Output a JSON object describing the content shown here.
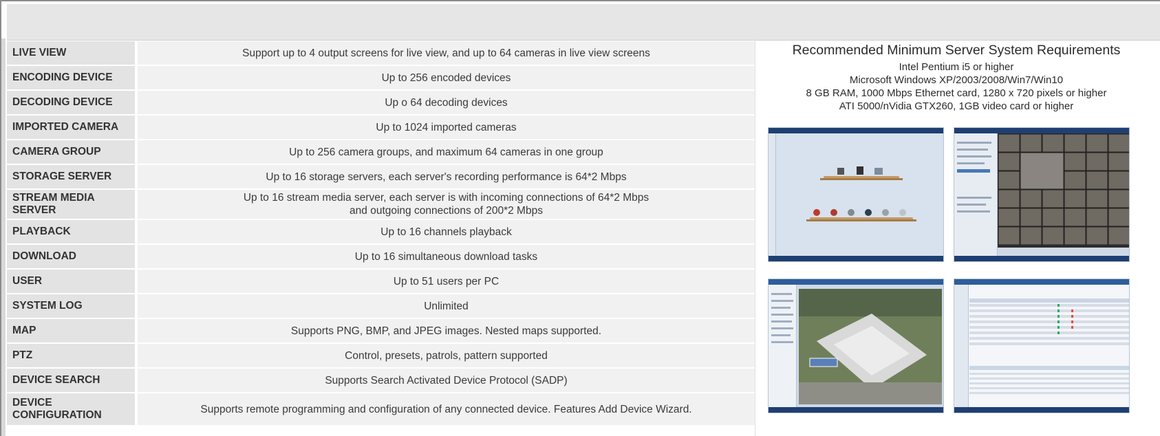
{
  "specs": [
    {
      "label": "LIVE VIEW",
      "value": "Support up to 4 output screens for live view, and up to 64 cameras in live view screens"
    },
    {
      "label": "ENCODING DEVICE",
      "value": "Up to 256 encoded devices"
    },
    {
      "label": "DECODING DEVICE",
      "value": "Up o 64 decoding devices"
    },
    {
      "label": "IMPORTED CAMERA",
      "value": "Up to 1024 imported cameras"
    },
    {
      "label": "CAMERA GROUP",
      "value": "Up to 256 camera groups, and maximum 64 cameras in one group"
    },
    {
      "label": "STORAGE SERVER",
      "value": "Up to 16 storage servers, each server's recording performance is 64*2 Mbps"
    },
    {
      "label": "STREAM MEDIA SERVER",
      "value_line1": "Up to 16 stream media server, each server is with incoming connections of 64*2 Mbps",
      "value_line2": "and outgoing connections of 200*2 Mbps"
    },
    {
      "label": "PLAYBACK",
      "value": "Up to 16 channels playback"
    },
    {
      "label": "DOWNLOAD",
      "value": "Up to 16 simultaneous download tasks"
    },
    {
      "label": "USER",
      "value": "Up to 51 users per PC"
    },
    {
      "label": "SYSTEM LOG",
      "value": "Unlimited"
    },
    {
      "label": "MAP",
      "value": "Supports PNG, BMP, and JPEG images. Nested maps supported."
    },
    {
      "label": "PTZ",
      "value": "Control, presets, patrols, pattern supported"
    },
    {
      "label": "DEVICE SEARCH",
      "value": "Supports Search Activated Device Protocol (SADP)"
    },
    {
      "label": "DEVICE CONFIGURATION",
      "value": "Supports remote programming and configuration of any connected device. Features Add Device Wizard."
    }
  ],
  "requirements": {
    "title": "Recommended Minimum Server System Requirements",
    "lines": [
      "Intel Pentium i5 or higher",
      "Microsoft Windows XP/2003/2008/Win7/Win10",
      "8 GB RAM, 1000 Mbps Ethernet card, 1280 x 720 pixels or higher",
      "ATI 5000/nVidia GTX260, 1GB video card or higher"
    ]
  },
  "screenshots": [
    {
      "name": "control-panel-screenshot",
      "shows": "control-panel"
    },
    {
      "name": "live-view-screenshot",
      "shows": "live-view-grid"
    },
    {
      "name": "map-screenshot",
      "shows": "aerial-map"
    },
    {
      "name": "device-management-screenshot",
      "shows": "device-list"
    }
  ],
  "colors": {
    "label_bg": "#e3e3e3",
    "value_bg": "#f1f1f1",
    "window_bar": "#1f3f73"
  }
}
